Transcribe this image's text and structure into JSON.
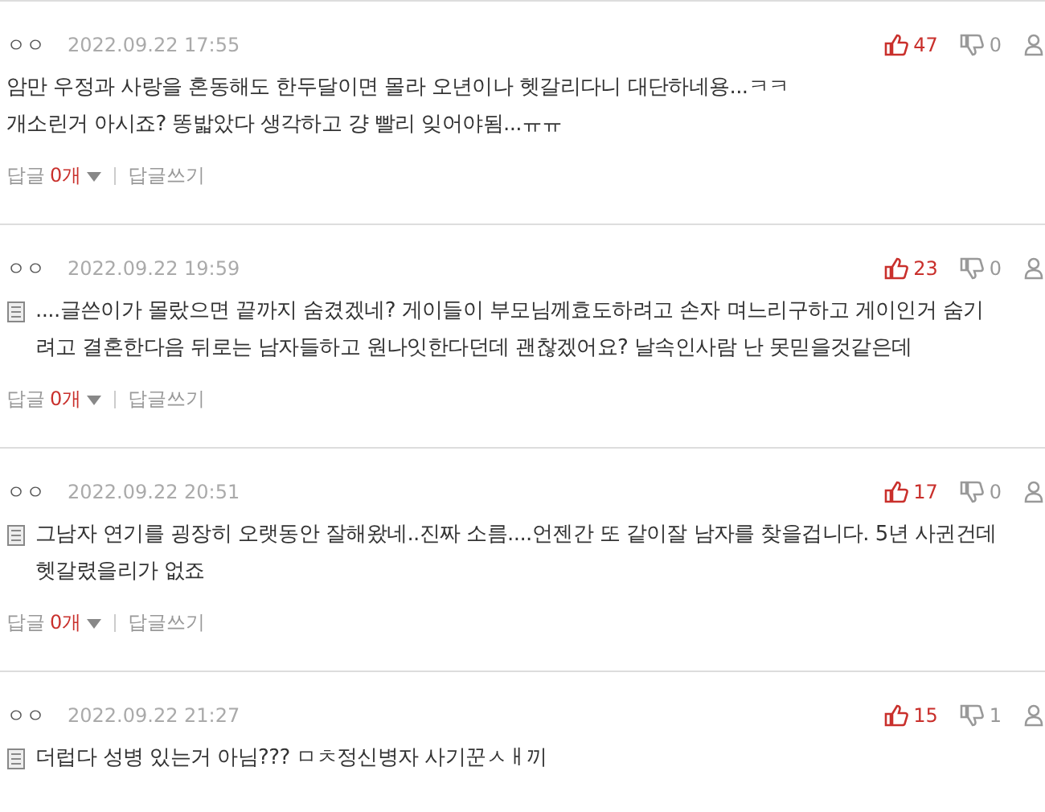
{
  "comments": [
    {
      "author": "ㅇㅇ",
      "date": "2022.09.22 17:55",
      "memo_icon": false,
      "text": "암만 우정과 사랑을 혼동해도 한두달이면 몰라 오년이나 헷갈리다니 대단하네용...ㅋㅋ\n개소린거 아시죠? 똥밟았다 생각하고 걍 빨리 잊어야됨...ㅠㅠ",
      "likes": "47",
      "dislikes": "0",
      "reply_label": "답글",
      "reply_count": "0개",
      "write_label": "답글쓰기"
    },
    {
      "author": "ㅇㅇ",
      "date": "2022.09.22 19:59",
      "memo_icon": true,
      "text": "....글쓴이가 몰랐으면 끝까지 숨겼겠네? 게이들이 부모님께효도하려고 손자 며느리구하고 게이인거 숨기\n려고 결혼한다음 뒤로는 남자들하고 원나잇한다던데 괜찮겠어요? 날속인사람 난 못믿을것같은데",
      "likes": "23",
      "dislikes": "0",
      "reply_label": "답글",
      "reply_count": "0개",
      "write_label": "답글쓰기"
    },
    {
      "author": "ㅇㅇ",
      "date": "2022.09.22 20:51",
      "memo_icon": true,
      "text": "그남자 연기를 굉장히 오랫동안 잘해왔네..진짜 소름....언젠간 또 같이잘 남자를 찾을겁니다. 5년 사귄건데\n헷갈렸을리가 없죠",
      "likes": "17",
      "dislikes": "0",
      "reply_label": "답글",
      "reply_count": "0개",
      "write_label": "답글쓰기"
    },
    {
      "author": "ㅇㅇ",
      "date": "2022.09.22 21:27",
      "memo_icon": true,
      "text": "더럽다 성병 있는거 아님??? ㅁㅊ정신병자 사기꾼ㅅㅐ끼",
      "likes": "15",
      "dislikes": "1"
    }
  ]
}
